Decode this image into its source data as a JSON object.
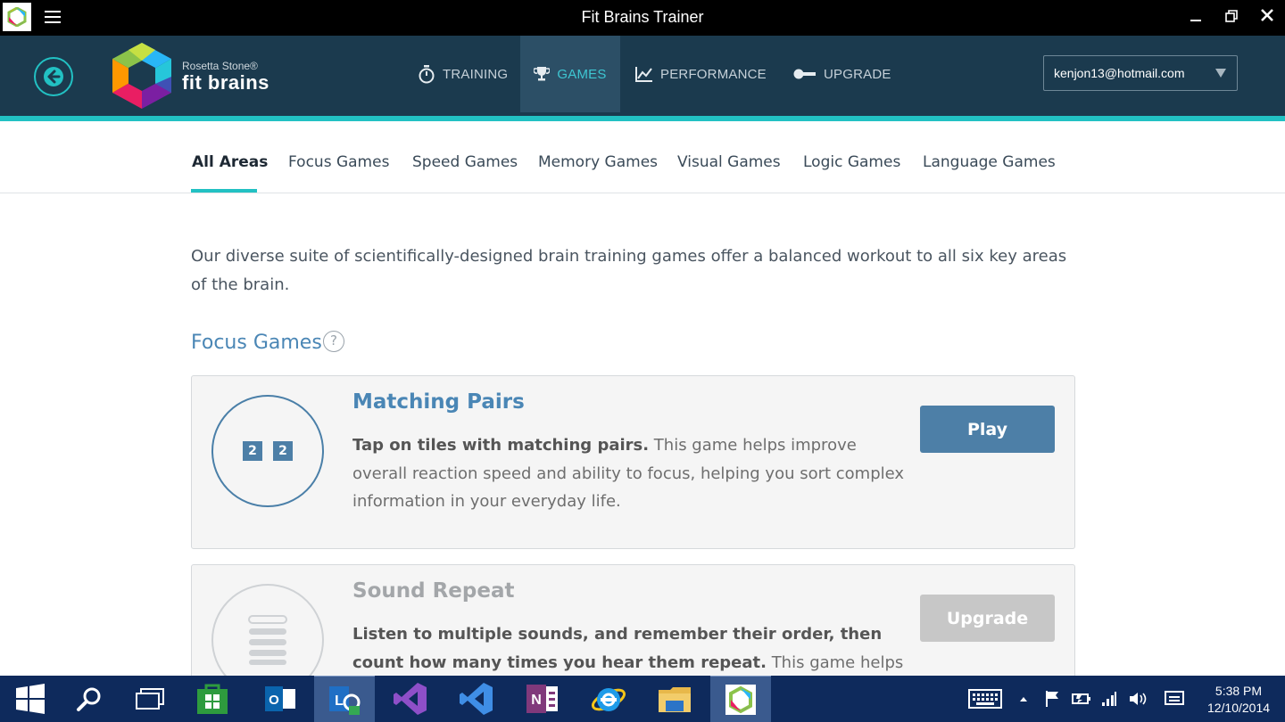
{
  "window": {
    "title": "Fit Brains Trainer"
  },
  "header": {
    "logo_small": "Rosetta Stone®",
    "logo_big": "fit brains",
    "nav": [
      {
        "label": "TRAINING",
        "icon": "stopwatch-icon"
      },
      {
        "label": "GAMES",
        "icon": "trophy-icon"
      },
      {
        "label": "PERFORMANCE",
        "icon": "chart-line-icon"
      },
      {
        "label": "UPGRADE",
        "icon": "key-icon"
      }
    ],
    "active_nav": "GAMES",
    "account": "kenjon13@hotmail.com"
  },
  "tabs": {
    "items": [
      "All Areas",
      "Focus Games",
      "Speed Games",
      "Memory Games",
      "Visual Games",
      "Logic Games",
      "Language Games"
    ],
    "active": "All Areas"
  },
  "intro": "Our diverse suite of scientifically-designed brain training games offer a balanced workout to all six key areas of the brain.",
  "section": {
    "title": "Focus Games",
    "help": "?"
  },
  "games": [
    {
      "title": "Matching Pairs",
      "icon_tiles": [
        "2",
        "2"
      ],
      "desc_bold": "Tap on tiles with matching pairs.",
      "desc_rest": " This game helps improve overall reaction speed and ability to focus, helping you sort complex information in your everyday life.",
      "button": "Play"
    },
    {
      "title": "Sound Repeat",
      "desc_bold": "Listen to multiple sounds, and remember their order, then count how many times you hear them repeat.",
      "desc_rest": " This game helps to",
      "button": "Upgrade"
    }
  ],
  "taskbar": {
    "time": "5:38 PM",
    "date": "12/10/2014"
  },
  "colors": {
    "header": "#1b3a4e",
    "accent": "#22c1c3",
    "link": "#4a86b5",
    "taskbar": "#0e2a5c"
  }
}
